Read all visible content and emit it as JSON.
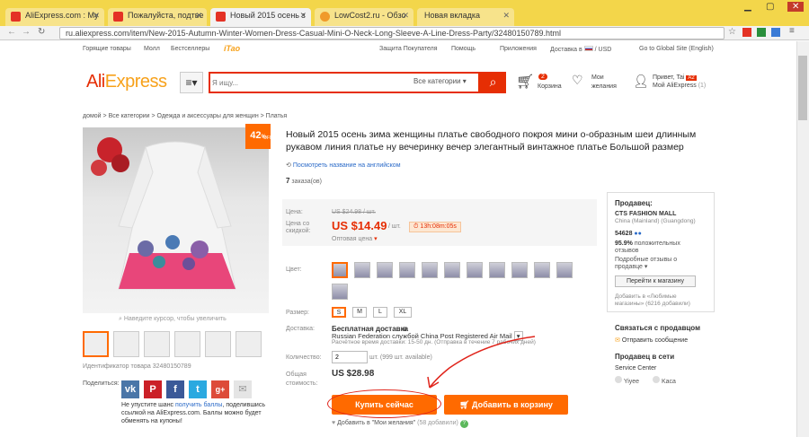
{
  "browser": {
    "tabs": [
      {
        "label": "AliExpress.com : My"
      },
      {
        "label": "Пожалуйста, подтве"
      },
      {
        "label": "Новый 2015 осень з"
      },
      {
        "label": "LowCost2.ru - Обзо"
      },
      {
        "label": "Новая вкладка"
      }
    ],
    "url": "ru.aliexpress.com/item/New-2015-Autumn-Winter-Women-Dress-Casual-Mini-O-Neck-Long-Sleeve-A-Line-Dress-Party/32480150789.html"
  },
  "topnav": {
    "hot": "Горящие товары",
    "mall": "Молл",
    "best": "Бестселлеры",
    "itao": "iTao",
    "protection": "Защита Покупателя",
    "help": "Помощь",
    "apps": "Приложения",
    "ship": "Доставка в",
    "currency": "/ USD",
    "global": "Go to Global Site (English)"
  },
  "header": {
    "logo_main": "Ali",
    "logo_accent": "Express",
    "search_placeholder": "Я ищу...",
    "category": "Все категории",
    "cart_count": "2",
    "cart_label": "Корзина",
    "wish_label1": "Мои",
    "wish_label2": "желания",
    "greet": "Привет, Tai",
    "myali": "Мой AliExpress",
    "myali_count": "(1)"
  },
  "breadcrumb": "домой > Все категории > Одежда и аксессуары для женщин > Платья",
  "product": {
    "title": "Новый 2015 осень зима женщины платье свободного покроя мини о-образным шеи длинным рукавом линия платье ну вечеринку вечер элегантный винтажное платье Большой размер",
    "translate": "Посмотреть название на английском",
    "orders_count": "7",
    "orders_label": "заказа(ов)",
    "discount": "42",
    "discount_suffix": "%",
    "discount_off": "OFF",
    "zoom_hint": "Наведите курсор, чтобы увеличить",
    "item_id": "Идентификатор товара 32480150789",
    "price_label": "Цена:",
    "old_price": "US $24.98 / шт.",
    "sale_label1": "Цена со",
    "sale_label2": "скидкой:",
    "price": "US $14.49",
    "price_unit": "/ шт.",
    "timer": "13h:08m:05s",
    "wholesale": "Оптовая цена",
    "color_label": "Цвет:",
    "size_label": "Размер:",
    "sizes": [
      "S",
      "M",
      "L",
      "XL"
    ],
    "delivery_label": "Доставка:",
    "delivery_free": "Бесплатная доставка",
    "delivery_to": "в",
    "delivery_country": "Russian Federation службой China Post Registered Air Mail",
    "delivery_time": "Расчётное время доставки: 15-50 дн. (Отправка в течение 7 рабочих дней)",
    "qty_label": "Количество:",
    "qty_value": "2",
    "qty_avail": "шт. (999 шт. available)",
    "total_label1": "Общая",
    "total_label2": "стоимость:",
    "total": "US $28.98",
    "buy": "Купить сейчас",
    "add_cart": "Добавить в корзину",
    "wish_add": "Добавить в \"Мои желания\"",
    "wish_count": "(58 добавили)"
  },
  "share": {
    "label": "Поделиться:",
    "icons": [
      "vk-icon",
      "pinterest-icon",
      "facebook-icon",
      "twitter-icon",
      "googleplus-icon",
      "email-icon"
    ],
    "note1": "Не упустите шанс",
    "note_link": "получить баллы",
    "note2": ", поделившись",
    "note3": "ссылкой на AliExpress.com. Баллы можно будет",
    "note4": "обменять на купоны!"
  },
  "seller": {
    "heading": "Продавец:",
    "name": "CTS FASHION MALL",
    "location": "China (Mainland) (Guangdong)",
    "score": "54628",
    "positive_pct": "95.9%",
    "positive_label1": "положительных",
    "positive_label2": "отзывов",
    "details1": "Подробные отзывы о",
    "details2": "продавце",
    "store_btn": "Перейти к магазину",
    "fav1": "Добавить в «Любимые",
    "fav2": "магазины»",
    "fav3": "(6216 добавили)",
    "contact_heading": "Связаться с продавцом",
    "send_msg": "Отправить сообщение",
    "online_heading": "Продавец в сети",
    "service_center": "Service Center",
    "agents": [
      "Yiyee",
      "Kaca"
    ]
  },
  "colors": {
    "brand": "#e62e04",
    "accent": "#ff6a00",
    "tabbar": "#f3d64a"
  }
}
